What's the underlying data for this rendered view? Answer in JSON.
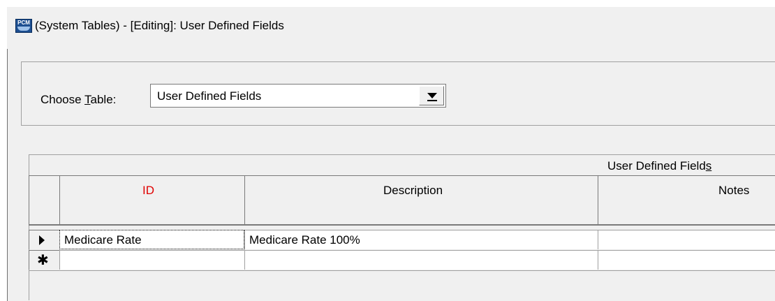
{
  "window": {
    "title": "(System Tables) - [Editing]:  User Defined Fields",
    "app_icon_text": "PCM"
  },
  "chooser": {
    "label_prefix": "Choose ",
    "label_hotkey": "T",
    "label_suffix": "able:",
    "selected_value": "User Defined Fields"
  },
  "grid": {
    "caption_prefix": "User Defined Field",
    "caption_hotkey": "s",
    "columns": [
      "ID",
      "Description",
      "Notes"
    ],
    "id_color": "#e00000",
    "rows": [
      {
        "id": "Medicare Rate",
        "description": "Medicare Rate 100%",
        "notes": ""
      }
    ],
    "new_row_marker": "✱"
  }
}
